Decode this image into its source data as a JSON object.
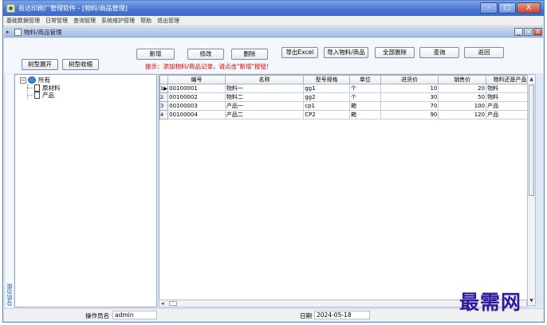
{
  "window": {
    "title": "易达印刷厂管理软件 - [物料/商品管理]",
    "controls": [
      "–",
      "□",
      "X"
    ]
  },
  "menu": [
    "基础数据管理",
    "日常管理",
    "查询管理",
    "系统维护管理",
    "帮助",
    "退出管理"
  ],
  "child": {
    "title": "物料/商品管理",
    "controls": [
      "_",
      "□",
      "X"
    ]
  },
  "toolbar": {
    "expand_tree": "树型展开",
    "collapse_tree": "树型收缩",
    "new": "新增",
    "edit": "修改",
    "delete": "删除",
    "export_excel": "导出Excel",
    "import": "导入物料/商品",
    "delete_all": "全部删除",
    "query": "查询",
    "back": "返回",
    "hint": "提示：添加物料/商品记录，请点击\"新增\"按钮！"
  },
  "tree": {
    "root": "所有",
    "children": [
      "原材料",
      "产品"
    ]
  },
  "side_tab": "导航功能",
  "grid": {
    "columns": [
      "编号",
      "名称",
      "型号规格",
      "单位",
      "进货价",
      "销售价",
      "物料还是产品"
    ],
    "rows": [
      {
        "row": "1",
        "code": "00100001",
        "name": "物料一",
        "spec": "gg1",
        "unit": "个",
        "buy": "10",
        "sell": "20",
        "kind": "物料"
      },
      {
        "row": "2",
        "code": "00100002",
        "name": "物料二",
        "spec": "gg2",
        "unit": "个",
        "buy": "30",
        "sell": "50",
        "kind": "物料"
      },
      {
        "row": "3",
        "code": "00100003",
        "name": "产品一",
        "spec": "cp1",
        "unit": "箱",
        "buy": "70",
        "sell": "100",
        "kind": "产品"
      },
      {
        "row": "4",
        "code": "00100004",
        "name": "产品二",
        "spec": "CP2",
        "unit": "箱",
        "buy": "90",
        "sell": "120",
        "kind": "产品"
      }
    ]
  },
  "status": {
    "operator_label": "操作员名",
    "operator": "admin",
    "date_label": "日期",
    "date": "2024-05-18"
  },
  "watermark": "最需网"
}
